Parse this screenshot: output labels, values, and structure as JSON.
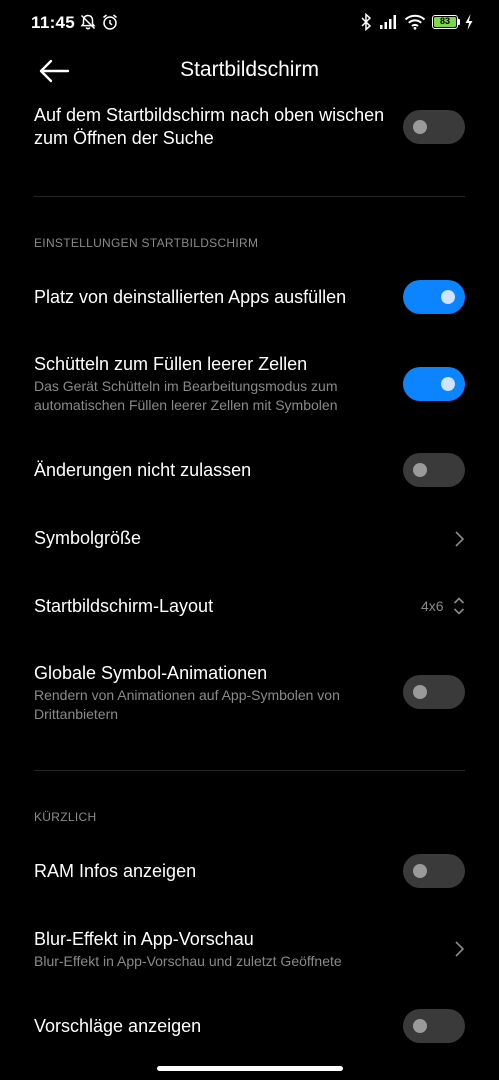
{
  "status": {
    "time": "11:45",
    "battery": "83"
  },
  "header": {
    "title": "Startbildschirm"
  },
  "rows": {
    "swipe_search": {
      "title": "Auf dem Startbildschirm nach oben wischen zum Öffnen der Suche",
      "on": false
    },
    "fill_uninstalled": {
      "title": "Platz von deinstallierten Apps ausfüllen",
      "on": true
    },
    "shake_fill": {
      "title": "Schütteln zum Füllen leerer Zellen",
      "subtitle": "Das Gerät Schütteln im Bearbeitungsmodus zum automatischen Füllen leerer Zellen mit Symbolen",
      "on": true
    },
    "lock_changes": {
      "title": "Änderungen nicht zulassen",
      "on": false
    },
    "icon_size": {
      "title": "Symbolgröße"
    },
    "layout": {
      "title": "Startbildschirm-Layout",
      "value": "4x6"
    },
    "global_anim": {
      "title": "Globale Symbol-Animationen",
      "subtitle": "Rendern von Animationen auf App-Symbolen von Drittanbietern",
      "on": false
    },
    "ram_info": {
      "title": "RAM Infos anzeigen",
      "on": false
    },
    "blur": {
      "title": "Blur-Effekt in App-Vorschau",
      "subtitle": "Blur-Effekt in App-Vorschau und zuletzt Geöffnete"
    },
    "suggestions": {
      "title": "Vorschläge anzeigen",
      "on": false
    }
  },
  "sections": {
    "home_settings": "EINSTELLUNGEN STARTBILDSCHIRM",
    "recent": "KÜRZLICH"
  },
  "icons": {
    "back": "arrow-left-icon",
    "mute": "bell-off-icon",
    "alarm": "alarm-clock-icon",
    "bluetooth": "bluetooth-icon",
    "signal": "cell-signal-icon",
    "wifi": "wifi-icon",
    "battery": "battery-icon",
    "charging": "charging-bolt-icon",
    "chevron": "chevron-right-icon",
    "updown": "chevron-updown-icon"
  },
  "colors": {
    "accent": "#0d84ff",
    "background": "#000000",
    "battery_fill": "#7bd84a"
  }
}
